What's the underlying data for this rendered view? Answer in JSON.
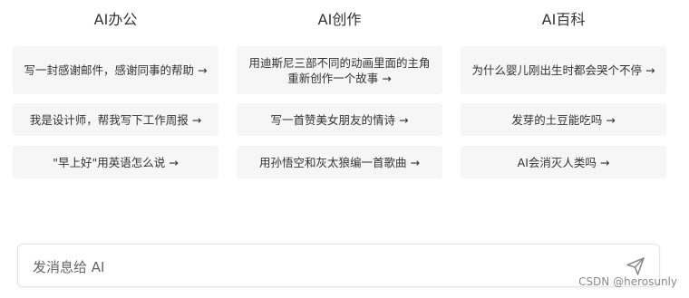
{
  "columns": [
    {
      "title": "AI办公",
      "prompts": [
        "写一封感谢邮件，感谢同事的帮助 →",
        "我是设计师，帮我写下工作周报 →",
        "\"早上好\"用英语怎么说 →"
      ]
    },
    {
      "title": "AI创作",
      "prompts": [
        "用迪斯尼三部不同的动画里面的主角重新创作一个故事 →",
        "写一首赞美女朋友的情诗 →",
        "用孙悟空和灰太狼编一首歌曲 →"
      ]
    },
    {
      "title": "AI百科",
      "prompts": [
        "为什么婴儿刚出生时都会哭个不停 →",
        "发芽的土豆能吃吗 →",
        "AI会消灭人类吗 →"
      ]
    }
  ],
  "input": {
    "placeholder": "发消息给 AI",
    "value": ""
  },
  "send_icon": "send-icon",
  "watermark": "CSDN @herosunly",
  "colors": {
    "card_bg": "#f6f6f6",
    "text": "#333333",
    "border": "#e4e4e4"
  }
}
